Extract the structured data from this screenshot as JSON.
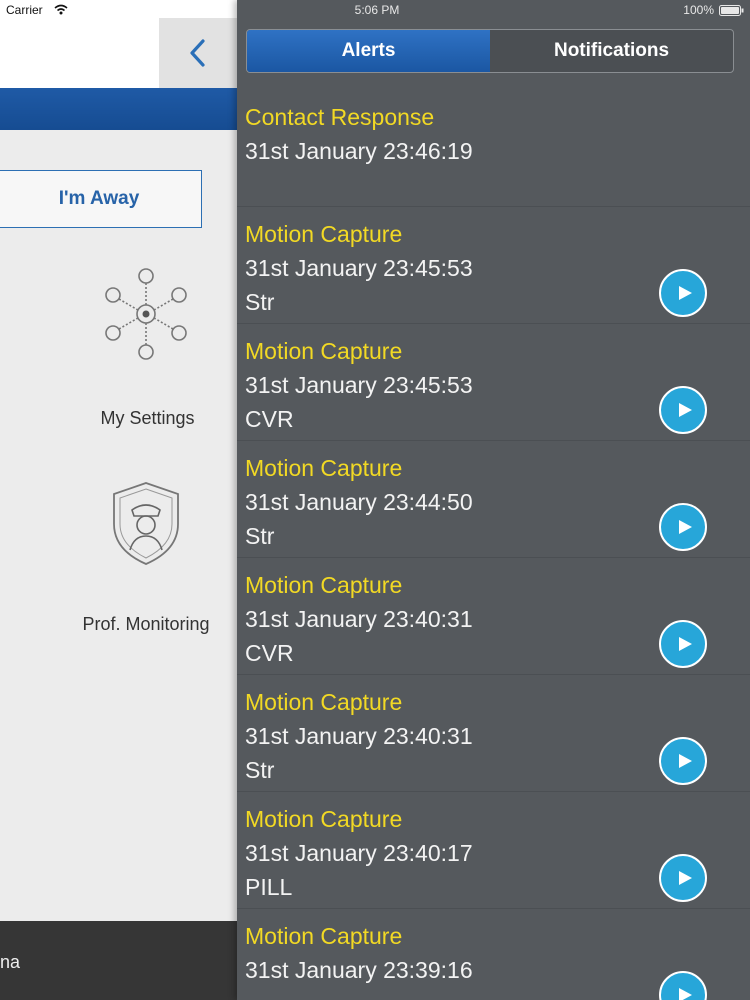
{
  "status_bar": {
    "carrier": "Carrier",
    "time": "5:06 PM",
    "battery": "100%"
  },
  "background_app": {
    "away_button": "I'm Away",
    "settings_label": "My Settings",
    "monitoring_label": "Prof. Monitoring",
    "footer_text": "na",
    "colors": {
      "brand_blue": "#1f5aa6",
      "footer": "#363636"
    }
  },
  "panel": {
    "tabs": [
      {
        "label": "Alerts",
        "active": true
      },
      {
        "label": "Notifications",
        "active": false
      }
    ],
    "colors": {
      "background": "#55595d",
      "title": "#f2d924",
      "play": "#27a6d9"
    },
    "alerts": [
      {
        "title": "Contact Response",
        "time": "31st January 23:46:19",
        "source": "",
        "has_play": false
      },
      {
        "title": "Motion Capture",
        "time": "31st January 23:45:53",
        "source": "Str",
        "has_play": true
      },
      {
        "title": "Motion Capture",
        "time": "31st January 23:45:53",
        "source": "CVR",
        "has_play": true
      },
      {
        "title": "Motion Capture",
        "time": "31st January 23:44:50",
        "source": "Str",
        "has_play": true
      },
      {
        "title": "Motion Capture",
        "time": "31st January 23:40:31",
        "source": "CVR",
        "has_play": true
      },
      {
        "title": "Motion Capture",
        "time": "31st January 23:40:31",
        "source": "Str",
        "has_play": true
      },
      {
        "title": "Motion Capture",
        "time": "31st January 23:40:17",
        "source": "PILL",
        "has_play": true
      },
      {
        "title": "Motion Capture",
        "time": "31st January 23:39:16",
        "source": "",
        "has_play": true
      }
    ]
  }
}
